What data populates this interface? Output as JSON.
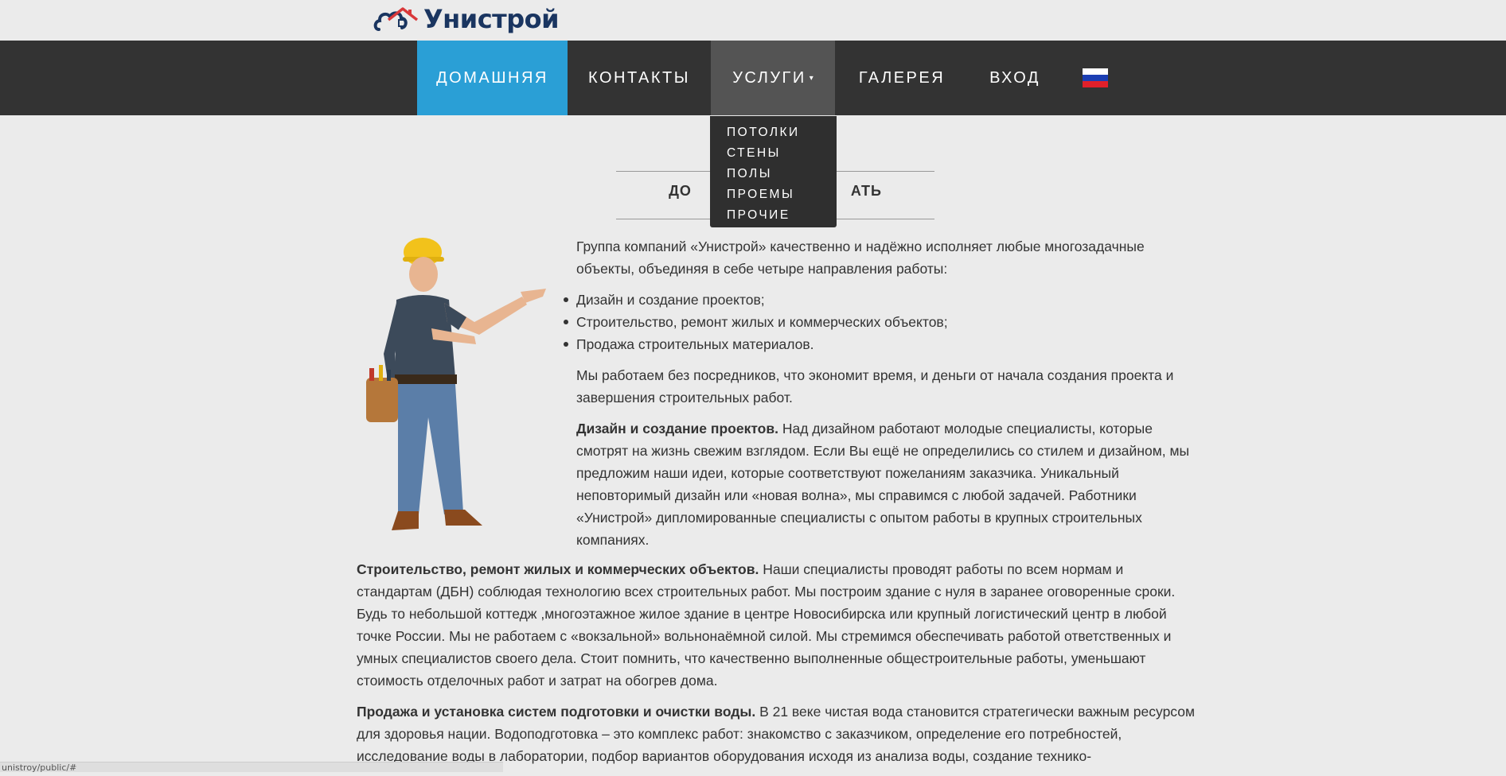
{
  "brand": {
    "name": "Унистрой"
  },
  "nav": {
    "items": [
      {
        "label": "ДОМАШНЯЯ"
      },
      {
        "label": "КОНТАКТЫ"
      },
      {
        "label": "УСЛУГИ"
      },
      {
        "label": "ГАЛЕРЕЯ"
      },
      {
        "label": "ВХОД"
      }
    ],
    "language_flag": "russia-flag-icon"
  },
  "dropdown": {
    "items": [
      "ПОТОЛКИ",
      "СТЕНЫ",
      "ПОЛЫ",
      "ПРОЕМЫ",
      "ПРОЧИЕ"
    ]
  },
  "page": {
    "heading_left": "ДО",
    "heading_right": "АТЬ",
    "intro": "Группа компаний «Унистрой» качественно и надёжно исполняет любые многозадачные объекты, объединяя в себе четыре направления работы:",
    "bullets": [
      "Дизайн и создание проектов;",
      "Строительство, ремонт жилых и коммерческих объектов;",
      "Продажа строительных материалов."
    ],
    "p2": "Мы работаем без посредников, что экономит время, и деньги от начала создания проекта и завершения строительных работ.",
    "p3_title": "Дизайн и создание проектов.",
    "p3_text": " Над дизайном работают молодые специалисты, которые смотрят на жизнь свежим взглядом. Если Вы ещё не определились со стилем и дизайном, мы предложим наши идеи, которые соответствуют пожеланиям заказчика. Уникальный неповторимый дизайн или «новая волна», мы справимся с любой задачей. Работники «Унистрой» дипломированные специалисты с опытом работы в крупных строительных компаниях.",
    "p4_title": "Строительство, ремонт жилых и коммерческих объектов.",
    "p4_text": " Наши специалисты проводят работы по всем нормам и стандартам (ДБН) соблюдая технологию всех строительных работ. Мы построим здание с нуля в заранее оговоренные сроки. Будь то небольшой коттедж ,многоэтажное жилое здание в центре Новосибирска или крупный логистический центр в любой точке России. Мы не работаем с «вокзальной» вольнонаёмной силой. Мы стремимся обеспечивать работой ответственных и умных специалистов своего дела. Стоит помнить, что качественно выполненные общестроительные работы, уменьшают стоимость отделочных работ и затрат на обогрев дома.",
    "p5_title": "Продажа и установка систем подготовки и очистки воды.",
    "p5_text": " В 21 веке чистая вода становится стратегически важным ресурсом для здоровья нации. Водоподготовка – это комплекс работ: знакомство с заказчиком, определение его потребностей, исследование воды в лаборатории, подбор вариантов оборудования исходя из анализа воды, создание технико-"
  },
  "status_bar": {
    "url": "unistroy/public/#"
  },
  "colors": {
    "accent": "#2a9fd6",
    "navbar": "#333333",
    "dropdown": "#2f2f2f",
    "background": "#ebebeb",
    "brand": "#1a3560",
    "brand_roof": "#d9383a"
  }
}
